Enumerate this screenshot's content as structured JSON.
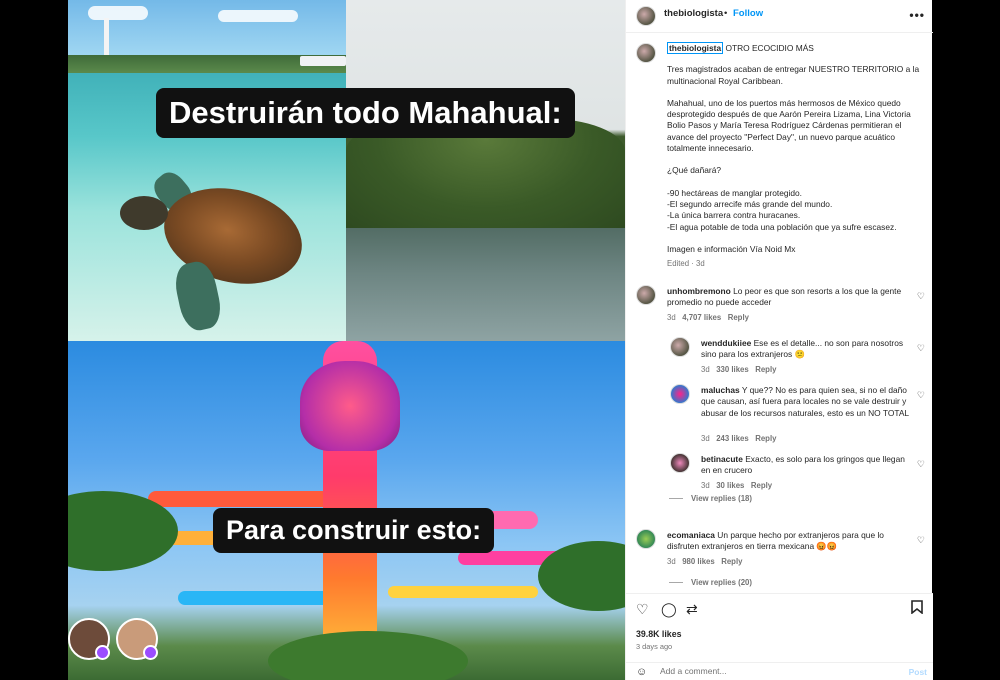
{
  "post": {
    "author": "thebiologista",
    "follow_label": "Follow",
    "more_icon": "more-horizontal-icon",
    "image": {
      "caption_top": "Destruirán todo Mahahual:",
      "caption_bottom": "Para construir esto:"
    },
    "caption": {
      "author": "thebiologista",
      "headline": "OTRO ECOCIDIO MÁS",
      "paragraph1": "Tres magistrados acaban de entregar NUESTRO TERRITORIO a la multinacional Royal Caribbean.",
      "paragraph2": "Mahahual, uno de los puertos más hermosos de México quedo desprotegido después de que Aarón Pereira Lizama, Lina Victoria Bolio Pasos y María Teresa Rodríguez Cárdenas permitieran el avance del proyecto \"Perfect Day\", un nuevo parque acuático totalmente innecesario.",
      "question": "¿Qué dañará?",
      "bullets": [
        "-90 hectáreas de manglar protegido.",
        "-El segundo arrecife más grande del mundo.",
        "-La única barrera contra huracanes.",
        "-El agua potable de toda una población que ya sufre escasez."
      ],
      "credit": "Imagen e información Vía Noid Mx",
      "meta": "Edited · 3d"
    },
    "comments": [
      {
        "user": "unhombremono",
        "text": "Lo peor es que son resorts a los que la gente promedio no puede acceder",
        "age": "3d",
        "likes": "4,707 likes",
        "reply": "Reply",
        "replies": [
          {
            "user": "wenddukiiee",
            "text": "Ese es el detalle... no son para nosotros sino para los extranjeros 😕",
            "age": "3d",
            "likes": "330 likes",
            "reply": "Reply"
          },
          {
            "user": "maluchas",
            "text": "Y que?? No es para quien sea, si no el daño que causan, así fuera para locales no se vale destruir y abusar de los recursos naturales, esto es un NO TOTAL",
            "age": "3d",
            "likes": "243 likes",
            "reply": "Reply"
          },
          {
            "user": "betinacute",
            "text": "Exacto, es solo para los gringos que llegan en en crucero",
            "age": "3d",
            "likes": "30 likes",
            "reply": "Reply"
          }
        ],
        "view_replies": "View replies (18)"
      },
      {
        "user": "ecomaniaca",
        "text": "Un parque hecho por extranjeros para que lo disfruten extranjeros en tierra mexicana 😡😡",
        "age": "3d",
        "likes": "980 likes",
        "reply": "Reply",
        "view_replies": "View replies (20)"
      }
    ],
    "likes_total": "39.8K likes",
    "date": "3 days ago",
    "comment_placeholder": "Add a comment...",
    "post_label": "Post"
  },
  "colors": {
    "accent": "#0095f6",
    "text": "#262626",
    "muted": "#737373"
  }
}
